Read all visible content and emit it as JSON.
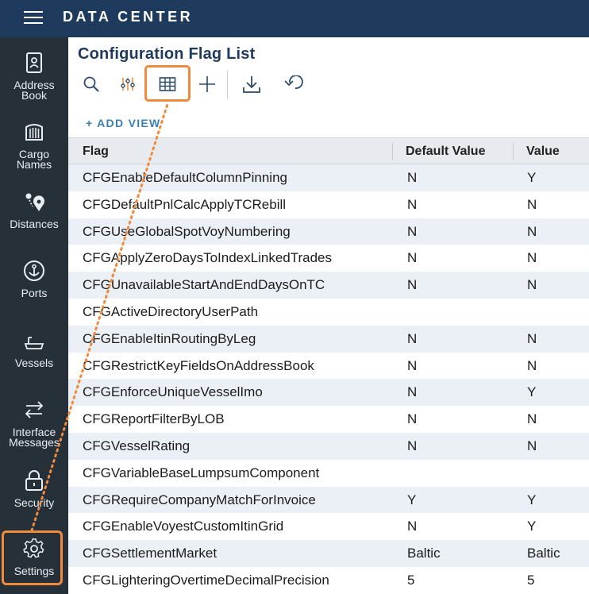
{
  "app": {
    "title": "DATA CENTER"
  },
  "sidebar": {
    "items": [
      {
        "label_1": "Address",
        "label_2": "Book",
        "icon": "address-book-icon"
      },
      {
        "label_1": "Cargo",
        "label_2": "Names",
        "icon": "cargo-icon"
      },
      {
        "label_1": "Distances",
        "label_2": "",
        "icon": "distances-icon"
      },
      {
        "label_1": "Ports",
        "label_2": "",
        "icon": "anchor-icon"
      },
      {
        "label_1": "Vessels",
        "label_2": "",
        "icon": "vessel-icon"
      },
      {
        "label_1": "Interface",
        "label_2": "Messages",
        "icon": "interface-arrows-icon"
      },
      {
        "label_1": "Security",
        "label_2": "",
        "icon": "lock-icon"
      },
      {
        "label_1": "Settings",
        "label_2": "",
        "icon": "gear-icon"
      }
    ]
  },
  "page": {
    "title": "Configuration Flag List",
    "add_view": "+ ADD VIEW"
  },
  "toolbar": {
    "icons": [
      "search-icon",
      "filter-sliders-icon",
      "grid-view-icon",
      "add-icon",
      "download-icon",
      "undo-icon"
    ]
  },
  "table": {
    "columns": [
      "Flag",
      "Default Value",
      "Value"
    ],
    "rows": [
      {
        "flag": "CFGEnableDefaultColumnPinning",
        "default": "N",
        "value": "Y"
      },
      {
        "flag": "CFGDefaultPnlCalcApplyTCRebill",
        "default": "N",
        "value": "N"
      },
      {
        "flag": "CFGUseGlobalSpotVoyNumbering",
        "default": "N",
        "value": "N"
      },
      {
        "flag": "CFGApplyZeroDaysToIndexLinkedTrades",
        "default": "N",
        "value": "N"
      },
      {
        "flag": "CFGUnavailableStartAndEndDaysOnTC",
        "default": "N",
        "value": "N"
      },
      {
        "flag": "CFGActiveDirectoryUserPath",
        "default": "",
        "value": ""
      },
      {
        "flag": "CFGEnableItinRoutingByLeg",
        "default": "N",
        "value": "N"
      },
      {
        "flag": "CFGRestrictKeyFieldsOnAddressBook",
        "default": "N",
        "value": "N"
      },
      {
        "flag": "CFGEnforceUniqueVesselImo",
        "default": "N",
        "value": "Y"
      },
      {
        "flag": "CFGReportFilterByLOB",
        "default": "N",
        "value": "N"
      },
      {
        "flag": "CFGVesselRating",
        "default": "N",
        "value": "N"
      },
      {
        "flag": "CFGVariableBaseLumpsumComponent",
        "default": "",
        "value": ""
      },
      {
        "flag": "CFGRequireCompanyMatchForInvoice",
        "default": "Y",
        "value": "Y"
      },
      {
        "flag": "CFGEnableVoyestCustomItinGrid",
        "default": "N",
        "value": "Y"
      },
      {
        "flag": "CFGSettlementMarket",
        "default": "Baltic",
        "value": "Baltic"
      },
      {
        "flag": "CFGLighteringOvertimeDecimalPrecision",
        "default": "5",
        "value": "5"
      }
    ]
  },
  "colors": {
    "topbar": "#1e3a5c",
    "sidebar": "#253039",
    "highlight": "#f08a3c",
    "accent": "#3d7fb3",
    "row_alt": "#eaf0f5"
  }
}
